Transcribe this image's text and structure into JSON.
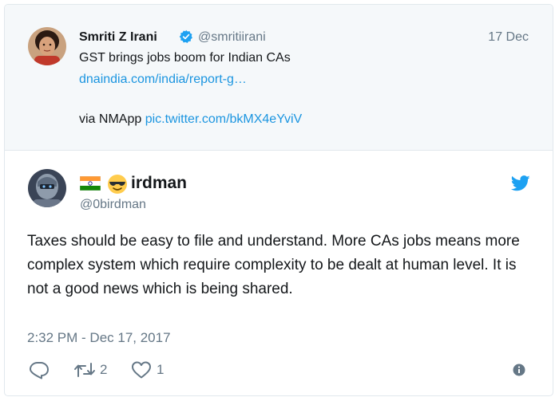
{
  "quoted_tweet": {
    "name": "Smriti Z Irani",
    "handle": "@smritiirani",
    "date": "17 Dec",
    "text": "GST brings jobs boom for Indian CAs",
    "link": "dnaindia.com/india/report-g…",
    "via_prefix": "via NMApp ",
    "pic_link": "pic.twitter.com/bkMX4eYviV",
    "verified_icon": "verified-badge-icon"
  },
  "reply_tweet": {
    "display_name": "irdman",
    "handle": "@0birdman",
    "text": "Taxes should be easy to file and understand. More CAs jobs means more complex system which require complexity to be dealt at human level. It is not a good news which is being shared.",
    "timestamp": "2:32 PM - Dec 17, 2017",
    "flag_icon": "india-flag-icon",
    "emoji_icon": "sunglasses-emoji-icon",
    "logo_icon": "twitter-bird-icon"
  },
  "actions": {
    "reply_icon": "reply-icon",
    "retweet_icon": "retweet-icon",
    "retweet_count": "2",
    "like_icon": "heart-icon",
    "like_count": "1",
    "info_icon": "info-icon"
  },
  "colors": {
    "link": "#1b95e0",
    "muted": "#657786",
    "text": "#14171a",
    "quoted_bg": "#f5f8fa"
  }
}
